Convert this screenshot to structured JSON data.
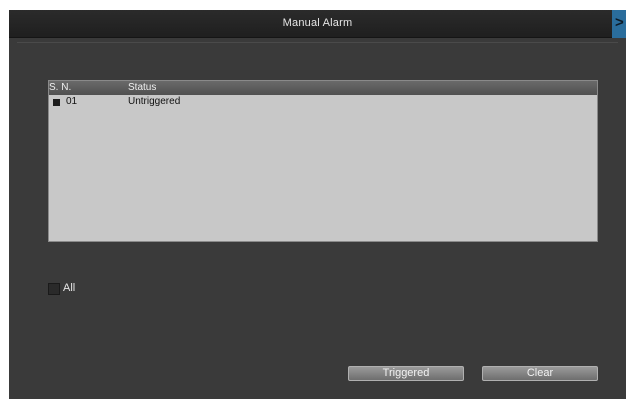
{
  "window": {
    "title": "Manual  Alarm",
    "close_glyph": ">"
  },
  "table": {
    "columns": [
      "S. N.",
      "Status"
    ],
    "rows": [
      {
        "sn": "01",
        "status": "Untriggered"
      }
    ]
  },
  "all_checkbox": {
    "label": "All",
    "checked": false
  },
  "buttons": {
    "triggered": "Triggered",
    "clear": "Clear"
  },
  "colors": {
    "background": "#3a3a3a",
    "titlebar": "#232323",
    "close_button": "#2a6d9c",
    "table_body": "#c8c8c8",
    "table_header": "#5a5a5a",
    "button": "#8a8a8a"
  }
}
